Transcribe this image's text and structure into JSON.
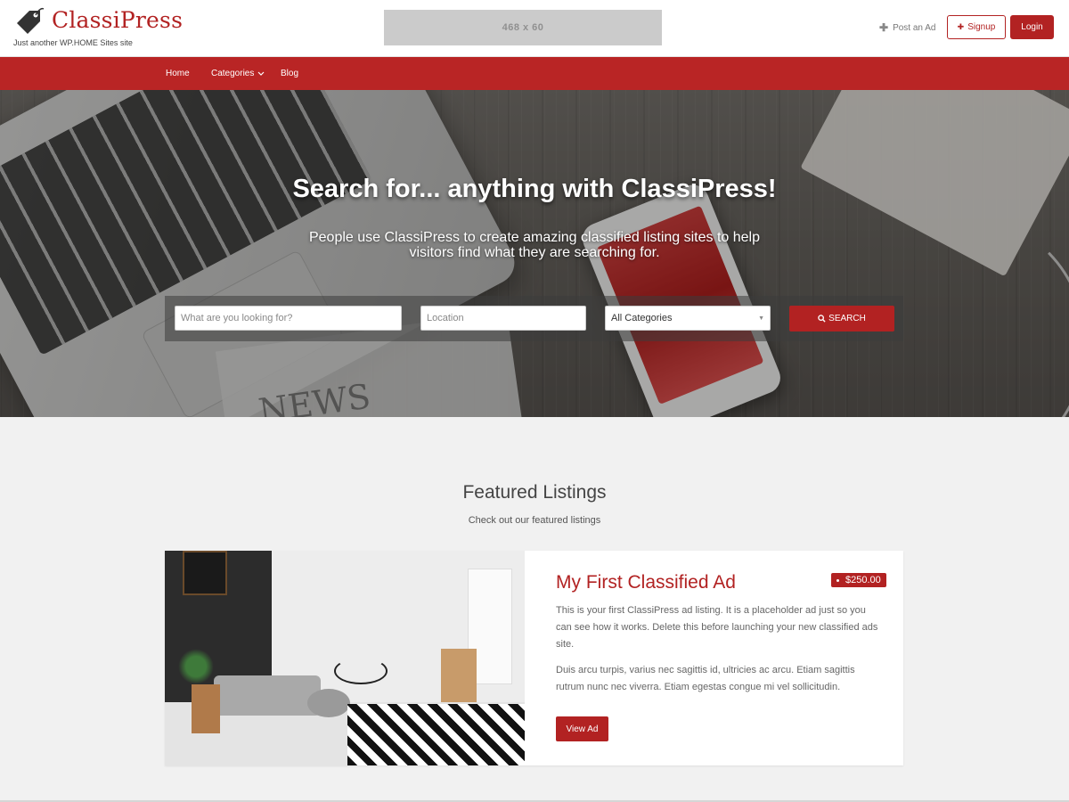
{
  "header": {
    "site_title": "ClassiPress",
    "tagline": "Just another WP.HOME Sites site",
    "ad_banner_text": "468 x 60",
    "post_ad_label": "Post an Ad",
    "signup_label": "Signup",
    "login_label": "Login"
  },
  "nav": {
    "items": [
      {
        "label": "Home"
      },
      {
        "label": "Categories"
      },
      {
        "label": "Blog"
      }
    ]
  },
  "hero": {
    "title": "Search for... anything with ClassiPress!",
    "subtitle": "People use ClassiPress to create amazing classified listing sites to help visitors find what they are searching for.",
    "background_text": "NEWS"
  },
  "search": {
    "keyword_placeholder": "What are you looking for?",
    "location_placeholder": "Location",
    "category_selected": "All Categories",
    "button_label": "SEARCH"
  },
  "featured": {
    "title": "Featured Listings",
    "subtitle": "Check out our featured listings",
    "listing": {
      "title": "My First Classified Ad",
      "price": "$250.00",
      "description_1": "This is your first ClassiPress ad listing. It is a placeholder ad just so you can see how it works. Delete this before launching your new classified ads site.",
      "description_2": "Duis arcu turpis, varius nec sagittis id, ultricies ac arcu. Etiam sagittis rutrum nunc nec viverra. Etiam egestas congue mi vel sollicitudin.",
      "button_label": "View Ad"
    }
  },
  "colors": {
    "accent": "#b22222",
    "nav_background": "#b92525",
    "page_background": "#f1f1f1"
  },
  "icons": {
    "logo": "price-tag-icon",
    "post_ad": "plus-icon",
    "signup": "plus-icon",
    "categories": "chevron-down-icon",
    "search": "search-icon",
    "select": "caret-down-icon",
    "price": "bullet-icon"
  }
}
